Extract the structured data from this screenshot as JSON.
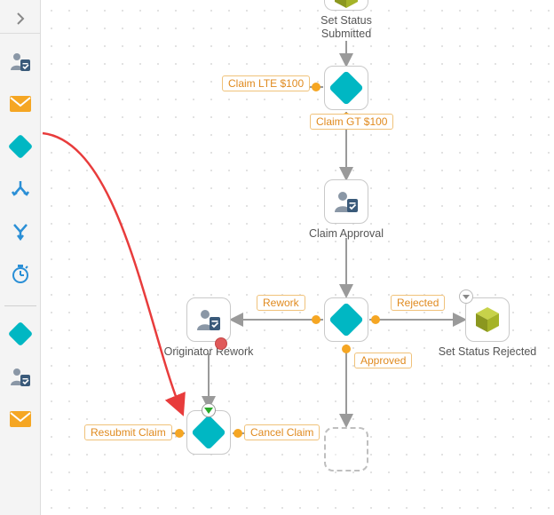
{
  "toolbar": {
    "items": [
      {
        "name": "collapse-toggle"
      },
      {
        "name": "user-task-tool"
      },
      {
        "name": "email-tool"
      },
      {
        "name": "decision-tool"
      },
      {
        "name": "split-tool"
      },
      {
        "name": "merge-tool"
      },
      {
        "name": "timer-tool"
      },
      {
        "separator": true
      },
      {
        "name": "decision-tool-alt"
      },
      {
        "name": "user-task-tool-alt"
      },
      {
        "name": "email-tool-alt"
      }
    ]
  },
  "workflow": {
    "nodes": {
      "setStatusSubmitted": {
        "label": "Set Status\nSubmitted"
      },
      "decisionClaimAmount": {
        "label": ""
      },
      "claimApproval": {
        "label": "Claim Approval"
      },
      "decisionApproval": {
        "label": ""
      },
      "originatorRework": {
        "label": "Originator Rework"
      },
      "setStatusRejected": {
        "label": "Set Status Rejected"
      },
      "resubmitDecision": {
        "label": ""
      },
      "placeholder": {
        "label": ""
      }
    },
    "edgeLabels": {
      "claimLte100": "Claim LTE $100",
      "claimGt100": "Claim GT $100",
      "rework": "Rework",
      "rejected": "Rejected",
      "approved": "Approved",
      "resubmitClaim": "Resubmit Claim",
      "cancelClaim": "Cancel Claim"
    }
  },
  "colors": {
    "accent": "#00b7c3",
    "edgeLabel": "#e08a1e",
    "connector": "#9a9a9a",
    "dragArrow": "#e83c3c",
    "cube": "#9aa82a"
  }
}
